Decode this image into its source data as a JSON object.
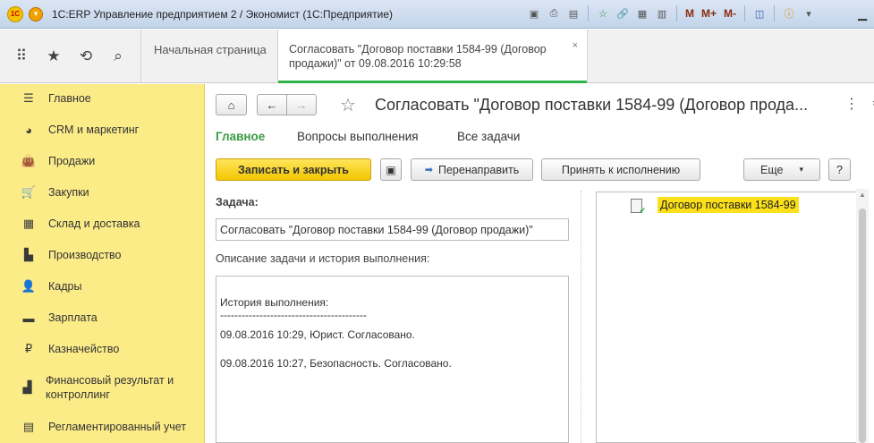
{
  "window": {
    "title": "1С:ERP Управление предприятием 2 / Экономист  (1С:Предприятие)",
    "logo_text": "1С",
    "toolbar": [
      "save-icon",
      "print-icon",
      "preview-icon",
      "favorite-icon",
      "link-icon",
      "calendar-icon",
      "calculator-icon"
    ],
    "memory_buttons": [
      "M",
      "M+",
      "M-"
    ],
    "controls": [
      "minimize",
      "restore",
      "close"
    ]
  },
  "topnav": {
    "home_tab": "Начальная страница",
    "active_tab": "Согласовать \"Договор поставки 1584-99 (Договор продажи)\" от 09.08.2016 10:29:58",
    "close_symbol": "×"
  },
  "sidebar": {
    "items": [
      {
        "label": "Главное",
        "icon": "menu-icon"
      },
      {
        "label": "CRM и маркетинг",
        "icon": "pie-chart-icon"
      },
      {
        "label": "Продажи",
        "icon": "shopping-bag-icon"
      },
      {
        "label": "Закупки",
        "icon": "cart-icon"
      },
      {
        "label": "Склад и доставка",
        "icon": "warehouse-icon"
      },
      {
        "label": "Производство",
        "icon": "factory-icon"
      },
      {
        "label": "Кадры",
        "icon": "person-icon"
      },
      {
        "label": "Зарплата",
        "icon": "money-icon"
      },
      {
        "label": "Казначейство",
        "icon": "ruble-icon"
      },
      {
        "label": "Финансовый результат и контроллинг",
        "icon": "chart-icon"
      },
      {
        "label": "Регламентированный учет",
        "icon": "ledger-icon"
      }
    ]
  },
  "form": {
    "title": "Согласовать \"Договор поставки 1584-99 (Договор прода...",
    "more_symbol": "⋮",
    "close_symbol": "×",
    "tabs": [
      "Главное",
      "Вопросы выполнения",
      "Все задачи"
    ],
    "buttons": {
      "save_close": "Записать и закрыть",
      "redirect": "Перенаправить",
      "accept": "Принять к исполнению",
      "more": "Еще",
      "help": "?"
    },
    "task_label": "Задача:",
    "task_value": "Согласовать \"Договор поставки 1584-99 (Договор продажи)\"",
    "desc_label": "Описание задачи и история выполнения:",
    "history": {
      "heading": "История выполнения:",
      "divider": "-----------------------------------------",
      "line1": "09.08.2016 10:29, Юрист. Согласовано.",
      "line2": "09.08.2016 10:27, Безопасность. Согласовано."
    },
    "attachment": "Договор поставки 1584-99"
  }
}
